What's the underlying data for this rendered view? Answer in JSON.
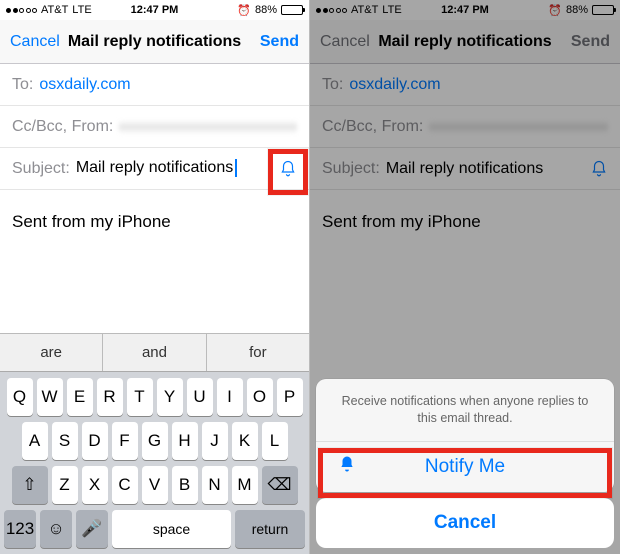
{
  "status": {
    "carrier": "AT&T",
    "net": "LTE",
    "time": "12:47 PM",
    "batt_pct": "88%",
    "batt_fill": 88
  },
  "nav": {
    "cancel": "Cancel",
    "title": "Mail reply notifications",
    "send": "Send"
  },
  "compose": {
    "to_label": "To:",
    "to_value": "osxdaily.com",
    "ccbcc_label": "Cc/Bcc, From:",
    "subject_label": "Subject:",
    "subject_value": "Mail reply notifications",
    "signature": "Sent from my iPhone"
  },
  "keyboard": {
    "suggestions": [
      "are",
      "and",
      "for"
    ],
    "row1": [
      "Q",
      "W",
      "E",
      "R",
      "T",
      "Y",
      "U",
      "I",
      "O",
      "P"
    ],
    "row2": [
      "A",
      "S",
      "D",
      "F",
      "G",
      "H",
      "J",
      "K",
      "L"
    ],
    "row3": [
      "Z",
      "X",
      "C",
      "V",
      "B",
      "N",
      "M"
    ],
    "numkey": "123",
    "space": "space",
    "return": "return"
  },
  "sheet": {
    "message": "Receive notifications when anyone replies to this email thread.",
    "notify": "Notify Me",
    "cancel": "Cancel"
  }
}
